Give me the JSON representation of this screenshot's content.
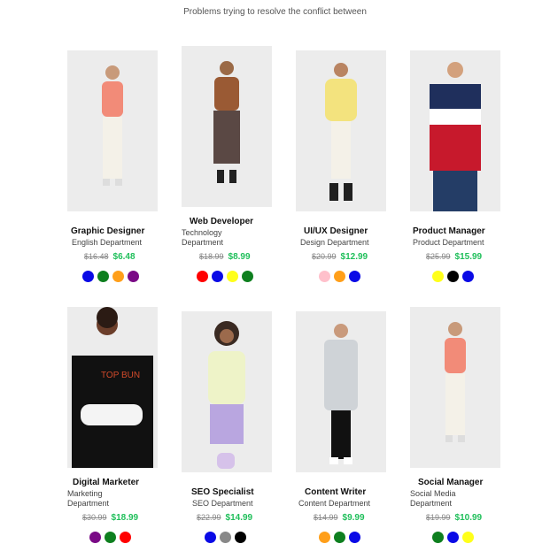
{
  "header": {
    "subtitle": "Problems trying to resolve the conflict between"
  },
  "products": [
    {
      "title": "Graphic Designer",
      "department": "English Department",
      "old_price": "$16.48",
      "price": "$6.48",
      "colors": [
        "#0a0ae6",
        "#0e7f1f",
        "#ff9f1a",
        "#7a0a86"
      ],
      "colors_label": [
        "blue",
        "green",
        "orange",
        "purple"
      ]
    },
    {
      "title": "Web Developer",
      "department": "Technology Department",
      "old_price": "$18.99",
      "price": "$8.99",
      "colors": [
        "#ff0000",
        "#0a0ae6",
        "#ffff1a",
        "#0e7f1f"
      ],
      "colors_label": [
        "red",
        "blue",
        "yellow",
        "green"
      ]
    },
    {
      "title": "UI/UX Designer",
      "department": "Design Department",
      "old_price": "$20.99",
      "price": "$12.99",
      "colors": [
        "#ffc0cb",
        "#ff9f1a",
        "#0a0ae6"
      ],
      "colors_label": [
        "pink",
        "orange",
        "blue"
      ]
    },
    {
      "title": "Product Manager",
      "department": "Product Department",
      "old_price": "$25.99",
      "price": "$15.99",
      "colors": [
        "#ffff1a",
        "#000000",
        "#0a0ae6"
      ],
      "colors_label": [
        "yellow",
        "black",
        "blue"
      ]
    },
    {
      "title": "Digital Marketer",
      "department": "Marketing Department",
      "old_price": "$30.99",
      "price": "$18.99",
      "colors": [
        "#7a0a86",
        "#0e7f1f",
        "#ff0000"
      ],
      "colors_label": [
        "purple",
        "green",
        "red"
      ]
    },
    {
      "title": "SEO Specialist",
      "department": "SEO Department",
      "old_price": "$22.99",
      "price": "$14.99",
      "colors": [
        "#0a0ae6",
        "#888888",
        "#000000"
      ],
      "colors_label": [
        "blue",
        "gray",
        "black"
      ]
    },
    {
      "title": "Content Writer",
      "department": "Content Department",
      "old_price": "$14.99",
      "price": "$9.99",
      "colors": [
        "#ff9f1a",
        "#0e7f1f",
        "#0a0ae6"
      ],
      "colors_label": [
        "orange",
        "green",
        "blue"
      ]
    },
    {
      "title": "Social Manager",
      "department": "Social Media Department",
      "old_price": "$19.99",
      "price": "$10.99",
      "colors": [
        "#0e7f1f",
        "#0a0ae6",
        "#ffff1a"
      ],
      "colors_label": [
        "green",
        "blue",
        "yellow"
      ]
    }
  ]
}
